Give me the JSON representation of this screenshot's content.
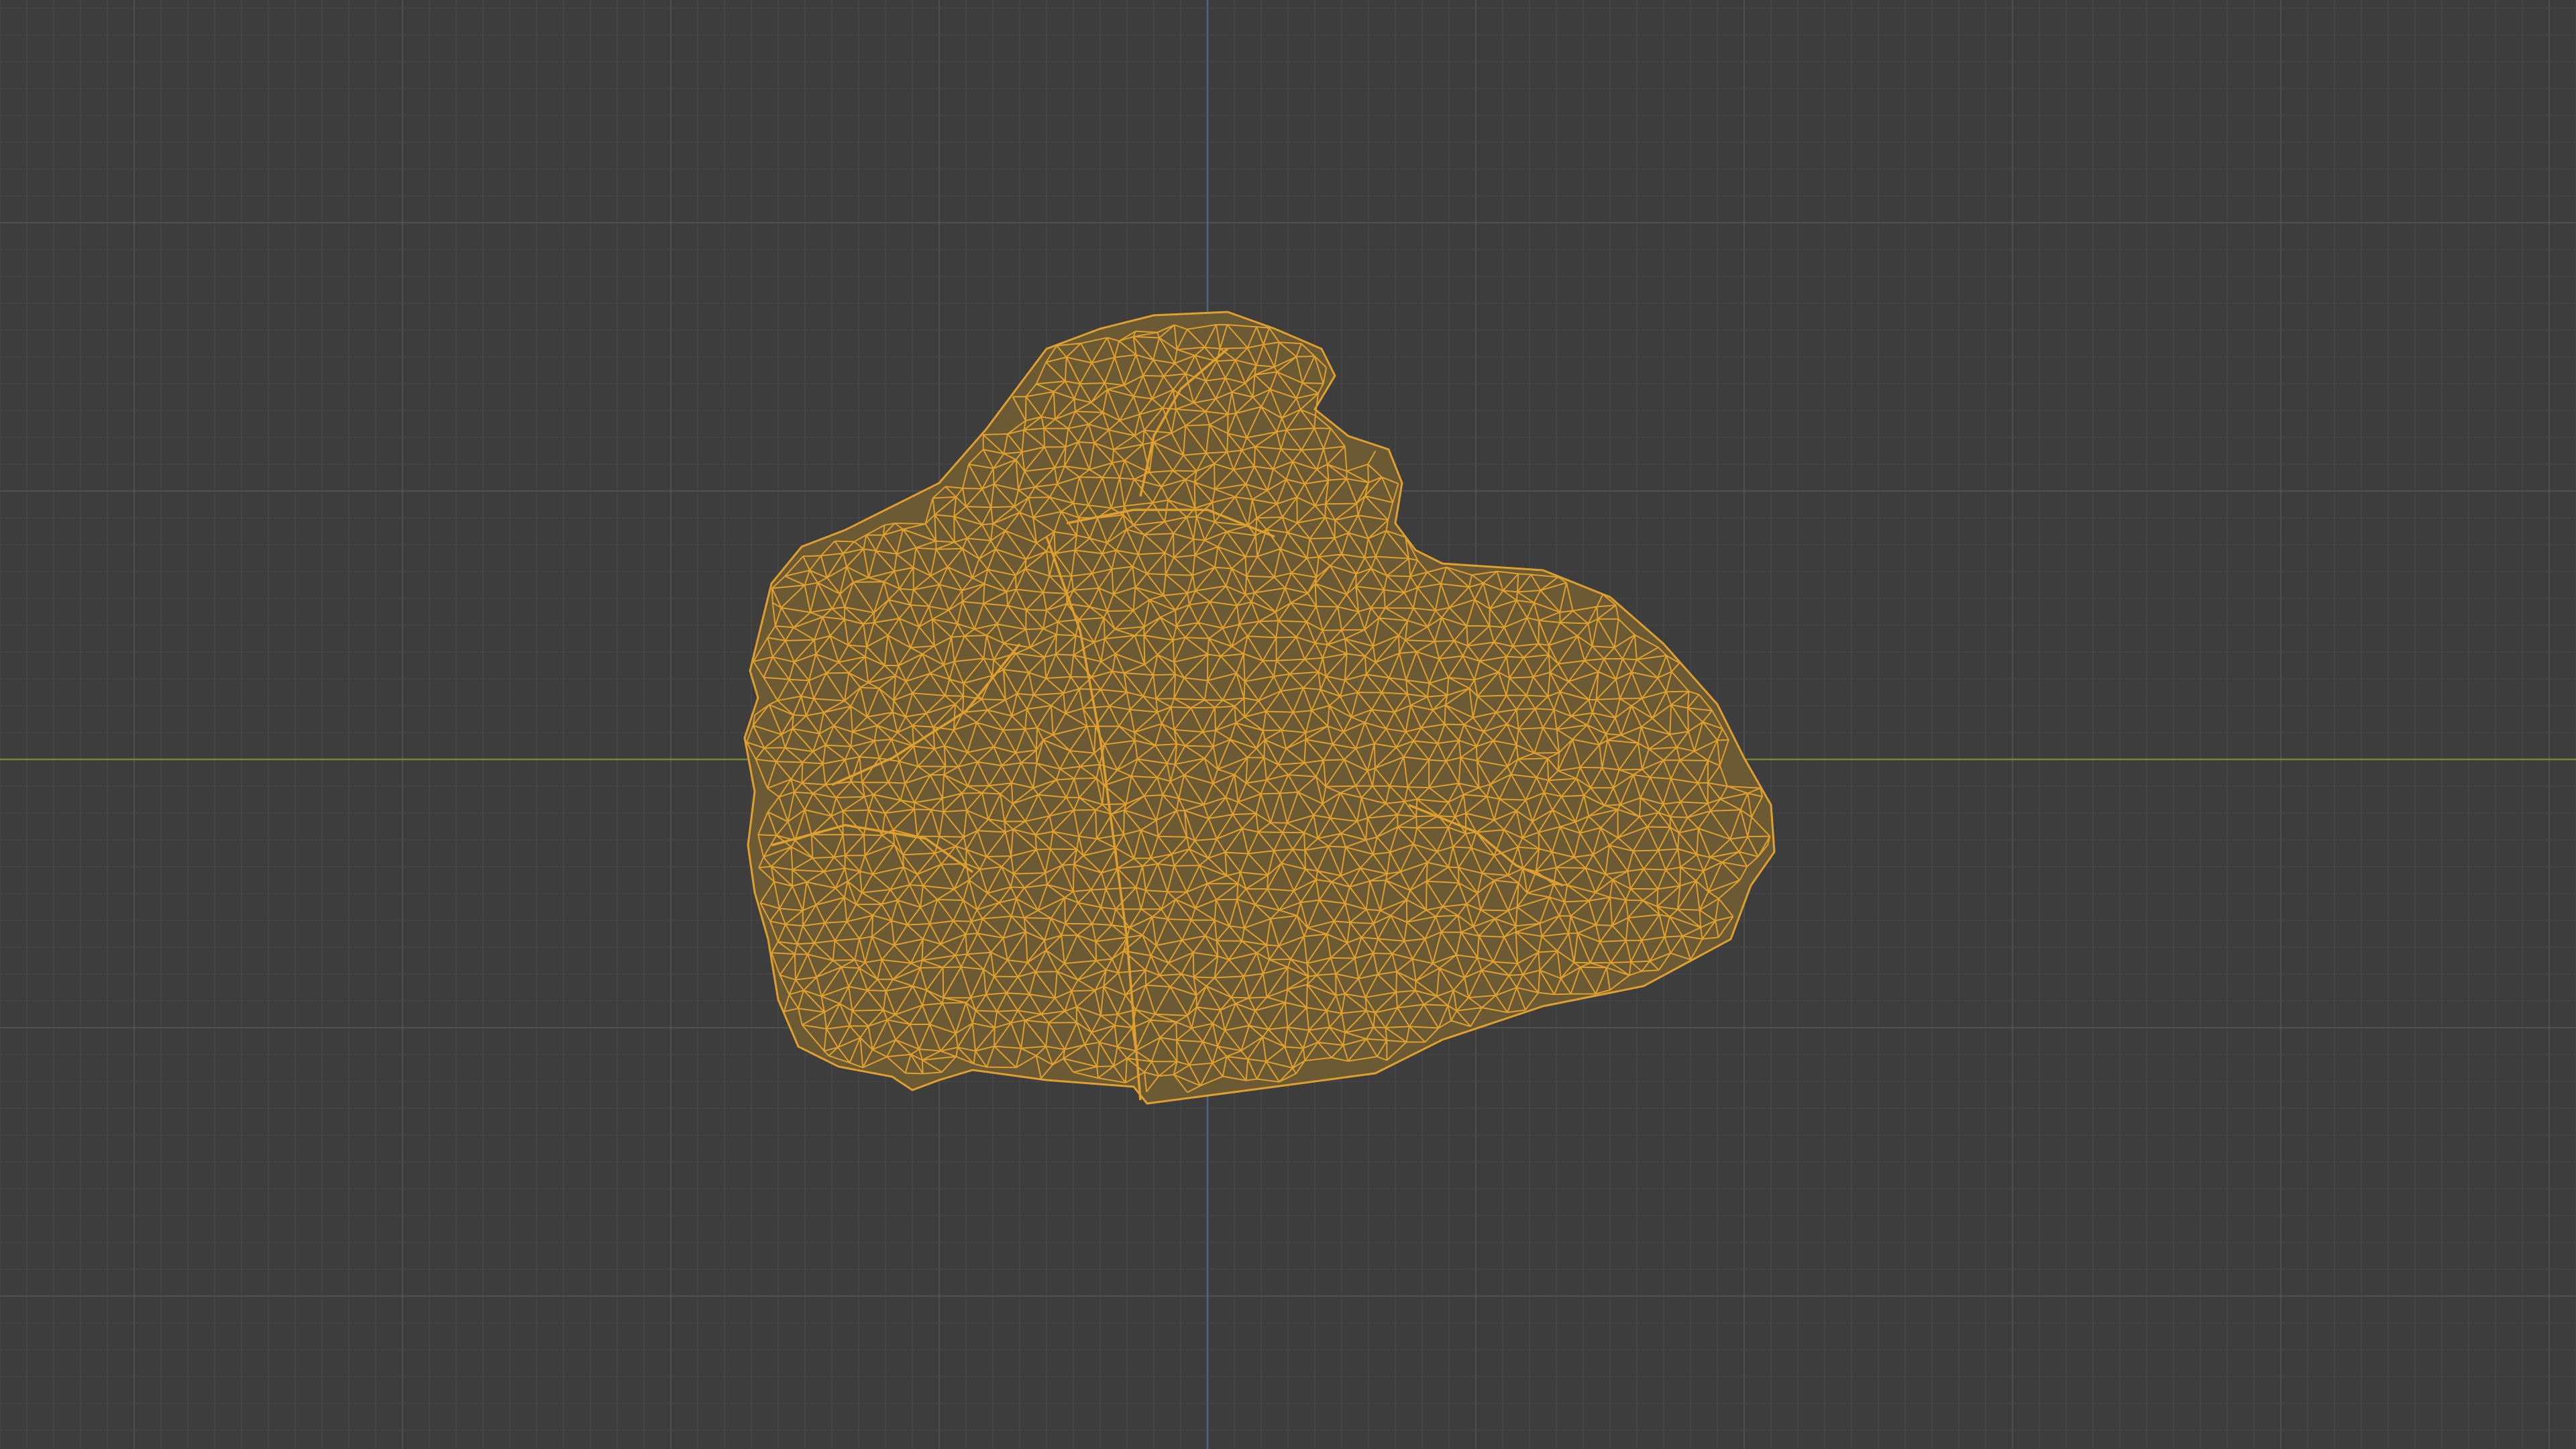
{
  "viewport": {
    "view": "wireframe",
    "object": "rock-mesh"
  },
  "colors": {
    "background": "#3d3d3d",
    "grid_minor": "#474747",
    "grid_major": "#505050",
    "axis_x": "#6f8a34",
    "axis_y": "#4f6684",
    "wire": "#e0a030",
    "mesh_fill": "#6b5a33"
  }
}
